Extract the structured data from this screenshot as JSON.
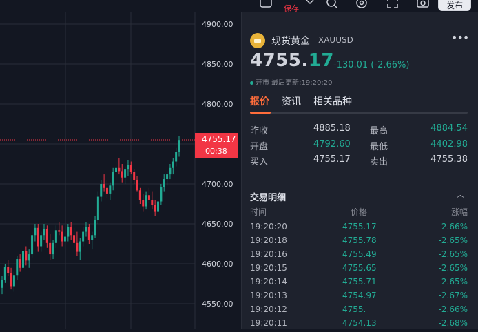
{
  "toolbar": {
    "save_label": "保存",
    "publish_label": "发布"
  },
  "chart": {
    "y_ticks": [
      "4900.00",
      "4850.00",
      "4800.00",
      "4750.00",
      "4700.00",
      "4650.00",
      "4600.00",
      "4550.00"
    ],
    "last_price_label": "4755.17",
    "countdown_label": "00:38",
    "candles": [
      [
        4570,
        4585,
        4562,
        4580
      ],
      [
        4580,
        4600,
        4576,
        4596
      ],
      [
        4596,
        4605,
        4585,
        4588
      ],
      [
        4588,
        4595,
        4568,
        4572
      ],
      [
        4572,
        4590,
        4565,
        4586
      ],
      [
        4586,
        4610,
        4580,
        4606
      ],
      [
        4606,
        4612,
        4590,
        4595
      ],
      [
        4595,
        4620,
        4590,
        4616
      ],
      [
        4616,
        4622,
        4598,
        4604
      ],
      [
        4604,
        4618,
        4595,
        4612
      ],
      [
        4612,
        4640,
        4608,
        4636
      ],
      [
        4636,
        4650,
        4628,
        4645
      ],
      [
        4645,
        4650,
        4615,
        4622
      ],
      [
        4622,
        4640,
        4615,
        4636
      ],
      [
        4636,
        4650,
        4630,
        4644
      ],
      [
        4644,
        4648,
        4620,
        4626
      ],
      [
        4626,
        4638,
        4605,
        4612
      ],
      [
        4612,
        4630,
        4606,
        4626
      ],
      [
        4626,
        4648,
        4620,
        4642
      ],
      [
        4642,
        4652,
        4636,
        4640
      ],
      [
        4640,
        4648,
        4622,
        4628
      ],
      [
        4628,
        4640,
        4618,
        4634
      ],
      [
        4634,
        4650,
        4628,
        4646
      ],
      [
        4646,
        4652,
        4630,
        4636
      ],
      [
        4636,
        4645,
        4620,
        4626
      ],
      [
        4626,
        4640,
        4610,
        4615
      ],
      [
        4615,
        4632,
        4605,
        4628
      ],
      [
        4628,
        4646,
        4622,
        4640
      ],
      [
        4640,
        4652,
        4634,
        4646
      ],
      [
        4646,
        4650,
        4625,
        4630
      ],
      [
        4630,
        4640,
        4618,
        4636
      ],
      [
        4636,
        4660,
        4632,
        4655
      ],
      [
        4655,
        4690,
        4650,
        4684
      ],
      [
        4684,
        4705,
        4678,
        4700
      ],
      [
        4700,
        4712,
        4690,
        4695
      ],
      [
        4695,
        4705,
        4682,
        4688
      ],
      [
        4688,
        4702,
        4680,
        4698
      ],
      [
        4698,
        4720,
        4692,
        4715
      ],
      [
        4715,
        4728,
        4705,
        4720
      ],
      [
        4720,
        4732,
        4712,
        4716
      ],
      [
        4716,
        4725,
        4702,
        4708
      ],
      [
        4708,
        4722,
        4700,
        4718
      ],
      [
        4718,
        4730,
        4710,
        4724
      ],
      [
        4724,
        4728,
        4712,
        4715
      ],
      [
        4715,
        4718,
        4700,
        4705
      ],
      [
        4705,
        4710,
        4690,
        4692
      ],
      [
        4692,
        4695,
        4675,
        4680
      ],
      [
        4680,
        4688,
        4665,
        4672
      ],
      [
        4672,
        4690,
        4668,
        4686
      ],
      [
        4686,
        4695,
        4676,
        4680
      ],
      [
        4680,
        4690,
        4668,
        4674
      ],
      [
        4674,
        4680,
        4660,
        4665
      ],
      [
        4665,
        4682,
        4660,
        4678
      ],
      [
        4678,
        4700,
        4674,
        4696
      ],
      [
        4696,
        4712,
        4690,
        4706
      ],
      [
        4706,
        4716,
        4698,
        4712
      ],
      [
        4712,
        4725,
        4706,
        4720
      ],
      [
        4720,
        4732,
        4712,
        4728
      ],
      [
        4728,
        4745,
        4722,
        4740
      ],
      [
        4740,
        4760,
        4734,
        4755
      ]
    ]
  },
  "quote": {
    "symbol_name": "现货黄金",
    "symbol_code": "XAUUSD",
    "price_int": "4755.",
    "price_dec": "17",
    "change_text": "-130.01 (-2.66%)",
    "status_text": "开市 最后更新:19:20:20",
    "tabs": [
      "报价",
      "资讯",
      "相关品种"
    ],
    "rows": [
      {
        "l1": "昨收",
        "v1": "4885.18",
        "l2": "最高",
        "v2": "4884.54",
        "c1": "white",
        "c2": "green"
      },
      {
        "l1": "开盘",
        "v1": "4792.60",
        "l2": "最低",
        "v2": "4402.98",
        "c1": "green",
        "c2": "green"
      },
      {
        "l1": "买入",
        "v1": "4755.17",
        "l2": "卖出",
        "v2": "4755.38",
        "c1": "white",
        "c2": "white"
      }
    ]
  },
  "trades": {
    "title": "交易明细",
    "headers": [
      "时间",
      "价格",
      "涨幅"
    ],
    "rows": [
      [
        "19:20:20",
        "4755.17",
        "-2.66%"
      ],
      [
        "19:20:18",
        "4755.78",
        "-2.65%"
      ],
      [
        "19:20:16",
        "4755.49",
        "-2.65%"
      ],
      [
        "19:20:15",
        "4755.65",
        "-2.65%"
      ],
      [
        "19:20:14",
        "4755.71",
        "-2.65%"
      ],
      [
        "19:20:13",
        "4754.97",
        "-2.67%"
      ],
      [
        "19:20:12",
        "4755.",
        "-2.66%"
      ],
      [
        "19:20:11",
        "4754.13",
        "-2.68%"
      ]
    ]
  },
  "colors": {
    "up": "#22ab94",
    "down": "#f23645",
    "accent": "#ff6d3b",
    "background": "#131722",
    "panel": "#1e222d"
  }
}
